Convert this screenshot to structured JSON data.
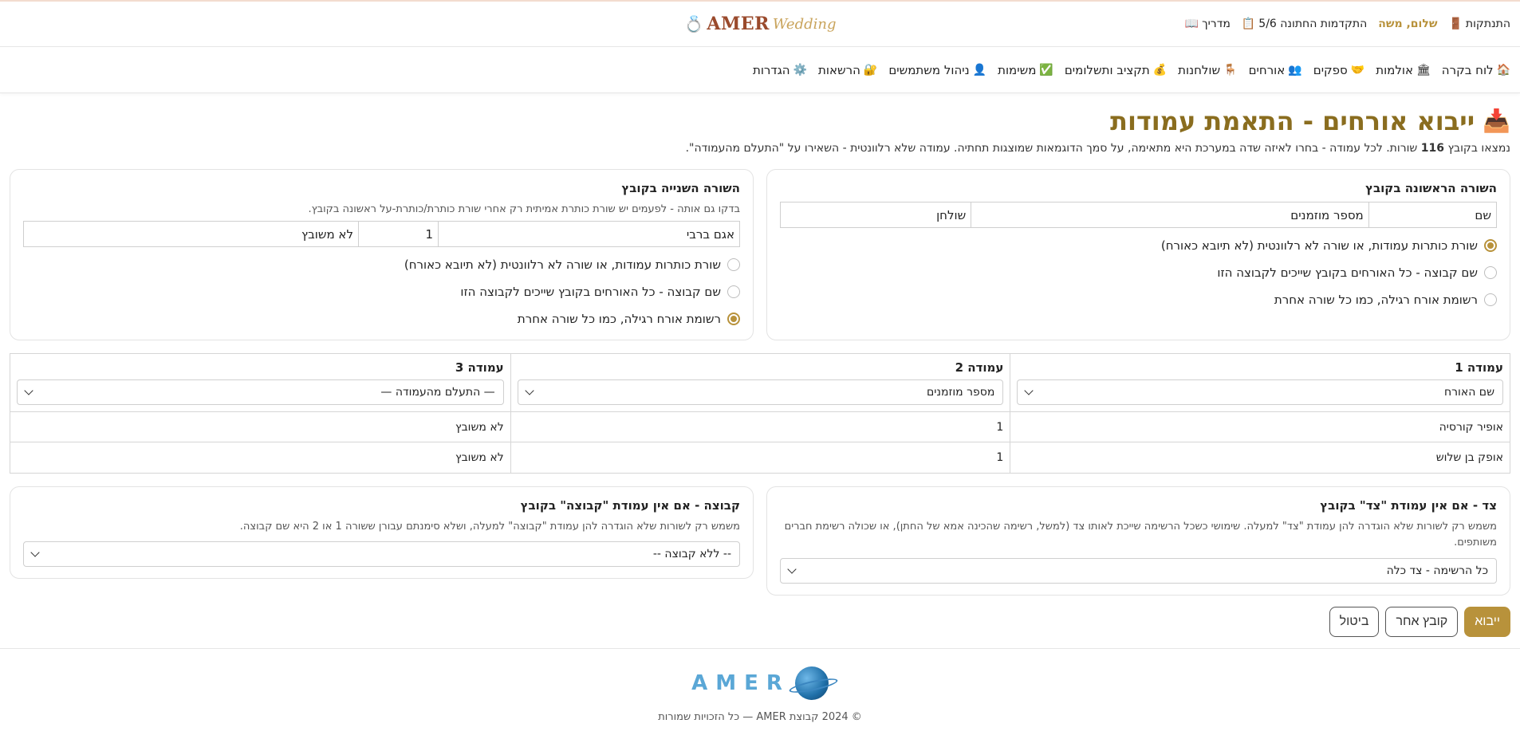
{
  "header": {
    "logout": "התנתקות",
    "greeting": "שלום, משה",
    "progress": "התקדמות החתונה 5/6",
    "guide": "מדריך",
    "logo_main": "AMER",
    "logo_script": "Wedding"
  },
  "nav": {
    "items": [
      {
        "label": "לוח בקרה",
        "icon": "house-icon"
      },
      {
        "label": "אולמות",
        "icon": "hall-icon"
      },
      {
        "label": "ספקים",
        "icon": "handshake-icon"
      },
      {
        "label": "אורחים",
        "icon": "guests-icon"
      },
      {
        "label": "שולחנות",
        "icon": "chair-icon"
      },
      {
        "label": "תקציב ותשלומים",
        "icon": "money-bag-icon"
      },
      {
        "label": "משימות",
        "icon": "check-icon"
      },
      {
        "label": "ניהול משתמשים",
        "icon": "user-icon"
      },
      {
        "label": "הרשאות",
        "icon": "lock-icon"
      },
      {
        "label": "הגדרות",
        "icon": "gear-icon"
      }
    ]
  },
  "page": {
    "title": "ייבוא אורחים - התאמת עמודות",
    "intro_prefix": "נמצאו בקובץ",
    "row_count": "116",
    "intro_suffix": "שורות. לכל עמודה - בחרו לאיזה שדה במערכת היא מתאימה, על סמך הדוגמאות שמוצגות תחתיה. עמודה שלא רלוונטית - השאירו על \"התעלם מהעמודה\"."
  },
  "first_row": {
    "title": "השורה הראשונה בקובץ",
    "cells": [
      "שם",
      "מספר מוזמנים",
      "שולחן"
    ],
    "options": [
      {
        "label": "שורת כותרות עמודות, או שורה לא רלוונטית (לא תיובא כאורח)",
        "checked": true
      },
      {
        "label": "שם קבוצה - כל האורחים בקובץ שייכים לקבוצה הזו",
        "checked": false
      },
      {
        "label": "רשומת אורח רגילה, כמו כל שורה אחרת",
        "checked": false
      }
    ]
  },
  "second_row": {
    "title": "השורה השנייה בקובץ",
    "help": "בדקו גם אותה - לפעמים יש שורת כותרת אמיתית רק אחרי שורת כותרת/כותרת-על ראשונה בקובץ.",
    "cells": [
      "אגם ברבי",
      "1",
      "לא משובץ"
    ],
    "options": [
      {
        "label": "שורת כותרות עמודות, או שורה לא רלוונטית (לא תיובא כאורח)",
        "checked": false
      },
      {
        "label": "שם קבוצה - כל האורחים בקובץ שייכים לקבוצה הזו",
        "checked": false
      },
      {
        "label": "רשומת אורח רגילה, כמו כל שורה אחרת",
        "checked": true
      }
    ]
  },
  "mapping": {
    "columns": [
      {
        "title": "עמודה 1",
        "selected": "שם האורח",
        "samples": [
          "אופיר קורסיה",
          "אופק בן שלוש"
        ]
      },
      {
        "title": "עמודה 2",
        "selected": "מספר מוזמנים",
        "samples": [
          "1",
          "1"
        ]
      },
      {
        "title": "עמודה 3",
        "selected": "— התעלם מהעמודה —",
        "samples": [
          "לא משובץ",
          "לא משובץ"
        ]
      }
    ]
  },
  "side": {
    "title": "צד - אם אין עמודת \"צד\" בקובץ",
    "help": "משמש רק לשורות שלא הוגדרה להן עמודת \"צד\" למעלה. שימושי כשכל הרשימה שייכת לאותו צד (למשל, רשימה שהכינה אמא של החתן), או שכולה רשימת חברים משותפים.",
    "selected": "כל הרשימה - צד כלה"
  },
  "group": {
    "title": "קבוצה - אם אין עמודת \"קבוצה\" בקובץ",
    "help": "משמש רק לשורות שלא הוגדרה להן עמודת \"קבוצה\" למעלה, ושלא סימנתם עבורן ששורה 1 או 2 היא שם קבוצה.",
    "selected": "-- ללא קבוצה --"
  },
  "actions": {
    "import": "ייבוא",
    "other_file": "קובץ אחר",
    "cancel": "ביטול"
  },
  "footer": {
    "logo": "AMER",
    "copyright": "© 2024 קבוצת AMER — כל הזכויות שמורות"
  },
  "colors": {
    "accent": "#b8923b",
    "title": "#8a6d1f"
  }
}
